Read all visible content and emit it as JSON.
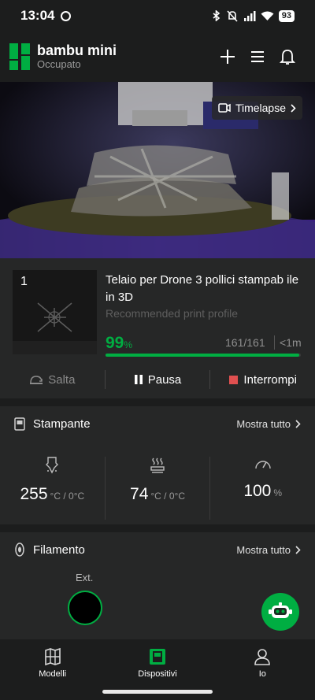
{
  "status": {
    "time": "13:04",
    "battery": "93"
  },
  "app": {
    "title": "bambu mini",
    "subtitle": "Occupato"
  },
  "camera": {
    "timelapse_label": "Timelapse"
  },
  "job": {
    "plate": "1",
    "title": "Telaio per Drone 3 pollici stampab ile in 3D",
    "profile": "Recommended print profile",
    "percent": "99",
    "percent_unit": "%",
    "progress_fraction": 0.99,
    "layers": "161/161",
    "time": "<1m",
    "skip_label": "Salta",
    "pause_label": "Pausa",
    "stop_label": "Interrompi"
  },
  "printer": {
    "title": "Stampante",
    "more": "Mostra tutto",
    "nozzle_temp": "255",
    "nozzle_unit": "°C / 0°C",
    "bed_temp": "74",
    "bed_unit": "°C / 0°C",
    "fan": "100",
    "fan_unit": "%"
  },
  "filament": {
    "title": "Filamento",
    "more": "Mostra tutto",
    "ext_label": "Ext."
  },
  "nav": {
    "models": "Modelli",
    "devices": "Dispositivi",
    "me": "Io"
  },
  "colors": {
    "accent": "#00ae42",
    "stop": "#e05050",
    "bg": "#1c1d1d",
    "card": "#262727"
  },
  "icons": [
    "bluetooth-icon",
    "mute-icon",
    "signal-icon",
    "wifi-icon",
    "add-icon",
    "menu-icon",
    "bell-icon",
    "camera-icon",
    "skip-icon",
    "pause-icon",
    "stop-icon",
    "printer-icon",
    "nozzle-icon",
    "heatbed-icon",
    "fan-icon",
    "filament-icon",
    "robot-icon",
    "models-icon",
    "devices-icon",
    "user-icon"
  ]
}
